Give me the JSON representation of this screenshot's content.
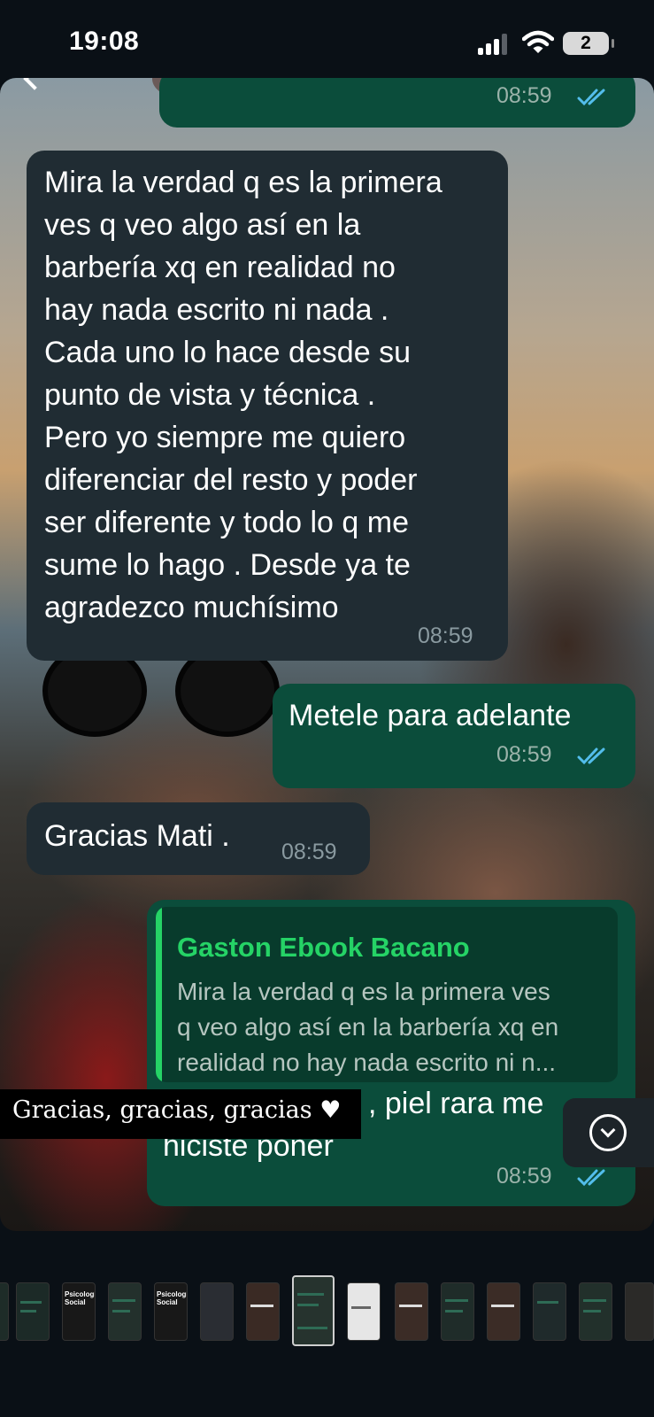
{
  "status_bar": {
    "time": "19:08",
    "battery_level": "2"
  },
  "chat": {
    "messages": [
      {
        "direction": "incoming",
        "lines": [
          "Mira la verdad q es la primera",
          "ves q veo algo así en la",
          "barbería xq en realidad no",
          "hay nada escrito ni nada .",
          "Cada uno lo hace desde su",
          "punto de vista y técnica .",
          "Pero yo siempre me quiero",
          "diferenciar del resto y poder",
          "ser diferente y todo lo q me",
          "sume lo hago . Desde ya te",
          "agradezco muchísimo"
        ],
        "time": "08:59"
      },
      {
        "direction": "outgoing",
        "text": "Metele para adelante",
        "time": "08:59",
        "status": "read"
      },
      {
        "direction": "incoming",
        "text": "Gracias Mati .",
        "time": "08:59"
      },
      {
        "direction": "outgoing",
        "quote": {
          "author": "Gaston Ebook Bacano",
          "lines": [
            "Mira la verdad q es la primera ves",
            "q veo algo así en la barbería xq en",
            "realidad no hay nada escrito ni n..."
          ]
        },
        "lines": [
          ", piel rara me",
          "hiciste poner"
        ],
        "time": "08:59",
        "status": "read"
      }
    ],
    "top_partial_time": "08:59"
  },
  "story_overlay": {
    "text": "Gracias, gracias, gracias ♥"
  },
  "thumbnails": {
    "labels": [
      "Psicología Social",
      "Psicología Social"
    ]
  },
  "colors": {
    "incoming_bubble": "#202c33",
    "outgoing_bubble": "#0b4d3b",
    "quote_author": "#25d366",
    "read_ticks": "#53bdeb"
  },
  "icons": {
    "scroll_down": "chevron-down-circle-icon",
    "read_receipt": "double-check-icon",
    "wifi": "wifi-icon",
    "signal": "cellular-signal-icon"
  }
}
